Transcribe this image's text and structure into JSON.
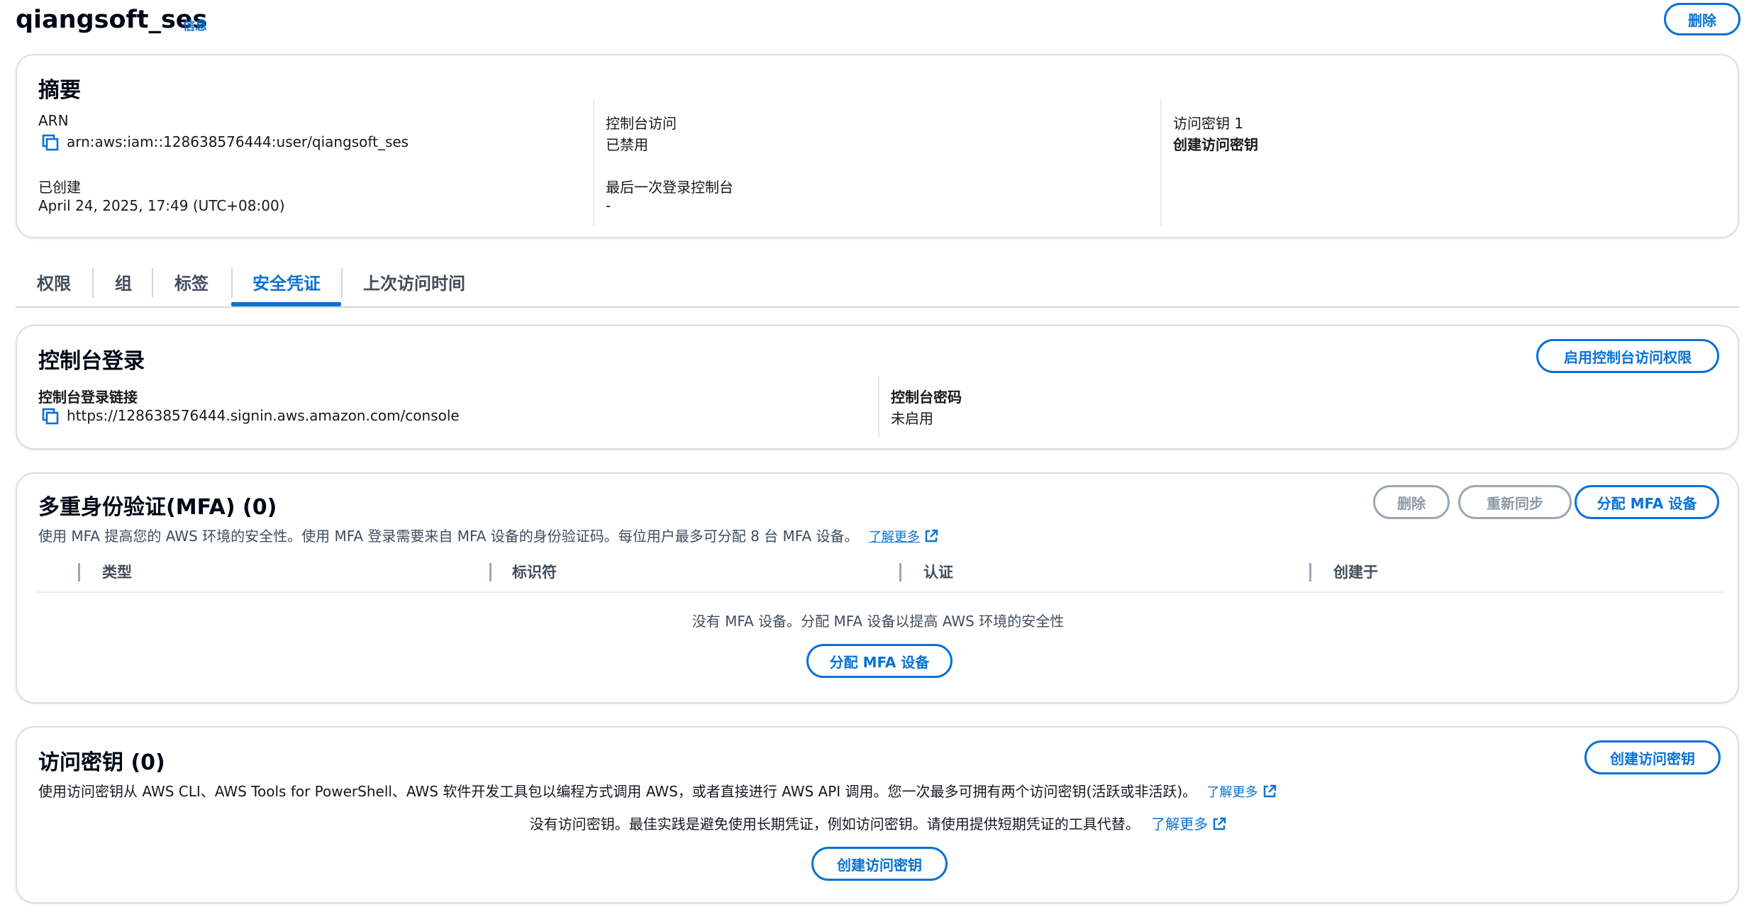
{
  "header": {
    "title": "qiangsoft_ses",
    "info_label": "信息",
    "delete_label": "删除"
  },
  "summary": {
    "title": "摘要",
    "arn_label": "ARN",
    "arn_value": "arn:aws:iam::128638576444:user/qiangsoft_ses",
    "created_label": "已创建",
    "created_value": "April 24, 2025, 17:49 (UTC+08:00)",
    "console_access_label": "控制台访问",
    "console_access_value": "已禁用",
    "last_login_label": "最后一次登录控制台",
    "last_login_value": "-",
    "access_key_label": "访问密钥 1",
    "create_access_key_link": "创建访问密钥"
  },
  "tabs": [
    {
      "label": "权限"
    },
    {
      "label": "组"
    },
    {
      "label": "标签"
    },
    {
      "label": "安全凭证"
    },
    {
      "label": "上次访问时间"
    }
  ],
  "active_tab": "安全凭证",
  "console_login": {
    "title": "控制台登录",
    "enable_button": "启用控制台访问权限",
    "link_label": "控制台登录链接",
    "link_value": "https://128638576444.signin.aws.amazon.com/console",
    "password_label": "控制台密码",
    "password_value": "未启用"
  },
  "mfa": {
    "title": "多重身份验证(MFA) (0)",
    "delete_button": "删除",
    "resync_button": "重新同步",
    "assign_button": "分配 MFA 设备",
    "description": "使用 MFA 提高您的 AWS 环境的安全性。使用 MFA 登录需要来自 MFA 设备的身份验证码。每位用户最多可分配 8 台 MFA 设备。",
    "learn_more": "了解更多",
    "columns": [
      "类型",
      "标识符",
      "认证",
      "创建于"
    ],
    "empty_text": "没有 MFA 设备。分配 MFA 设备以提高 AWS 环境的安全性",
    "empty_button": "分配 MFA 设备"
  },
  "access_keys": {
    "title": "访问密钥 (0)",
    "create_button": "创建访问密钥",
    "description": "使用访问密钥从 AWS CLI、AWS Tools for PowerShell、AWS 软件开发工具包以编程方式调用 AWS，或者直接进行 AWS API 调用。您一次最多可拥有两个访问密钥(活跃或非活跃)。",
    "learn_more": "了解更多",
    "empty_text": "没有访问密钥。最佳实践是避免使用长期凭证，例如访问密钥。请使用提供短期凭证的工具代替。",
    "empty_learn_more": "了解更多",
    "empty_button": "创建访问密钥"
  },
  "colors": {
    "accent": "#0972d3",
    "text": "#16191f",
    "muted": "#414d5c",
    "border": "#dedee3",
    "disabled": "#8d99a8"
  }
}
